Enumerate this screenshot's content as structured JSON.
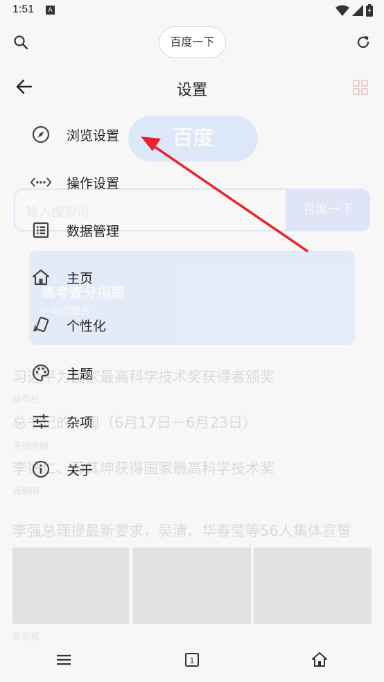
{
  "status_bar": {
    "time": "1:51",
    "notif_badge": "A"
  },
  "top_bar": {
    "query": "百度一下"
  },
  "background": {
    "logo": "百度",
    "search_placeholder": "输入搜索词",
    "search_button": "百度一下",
    "banner_title": "高考查分指南",
    "banner_subtitle": "一站式服务",
    "news": [
      {
        "title": "习近平为国家最高科学技术奖获得者颁奖",
        "source": "新华社"
      },
      {
        "title": "总书记的一周（6月17日－6月23日）",
        "source": "央视新闻"
      },
      {
        "title": "李德仁、薛其坤获得国家最高科学技术奖",
        "source": "光明网"
      },
      {
        "title": "李强总理提最新要求，吴清、华春莹等56人集体宣誓",
        "source": "新京报"
      }
    ]
  },
  "settings": {
    "title": "设置",
    "items": [
      {
        "label": "浏览设置",
        "icon": "compass-icon"
      },
      {
        "label": "操作设置",
        "icon": "code-dots-icon"
      },
      {
        "label": "数据管理",
        "icon": "list-icon"
      },
      {
        "label": "主页",
        "icon": "home-icon"
      },
      {
        "label": "个性化",
        "icon": "palette-card-icon"
      },
      {
        "label": "主题",
        "icon": "palette-icon"
      },
      {
        "label": "杂项",
        "icon": "sliders-icon"
      },
      {
        "label": "关于",
        "icon": "info-icon"
      }
    ]
  },
  "bottom_nav": {
    "tab_count": "1"
  },
  "colors": {
    "annotation": "#e8232b",
    "icon": "#444444",
    "text": "#222222"
  }
}
